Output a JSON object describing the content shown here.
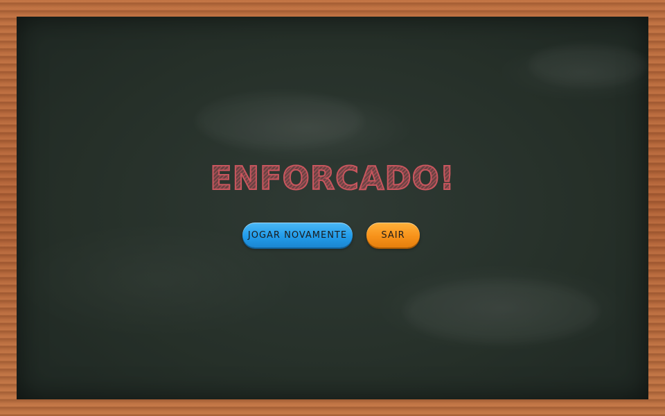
{
  "game": {
    "title": "ENFORCADO!",
    "colors": {
      "board": "#263029",
      "frame_wood": "#b86a3e",
      "title": "#c9565e",
      "play_button": "#229cea",
      "exit_button": "#f7921a"
    }
  },
  "buttons": {
    "play_again_label": "JOGAR NOVAMENTE",
    "exit_label": "SAIR"
  }
}
